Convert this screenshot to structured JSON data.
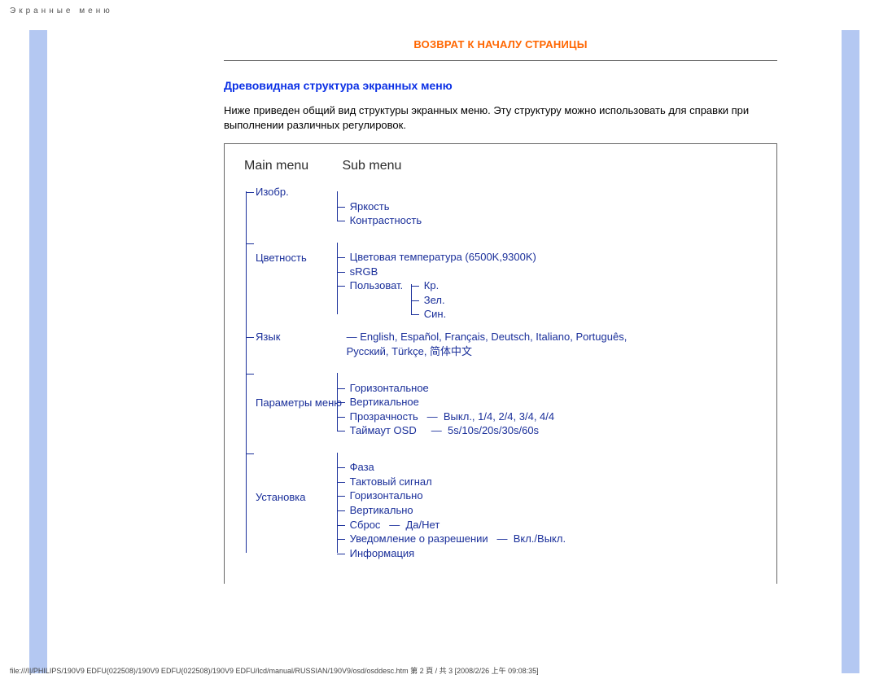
{
  "header_letterspaced": "Экранные меню",
  "back_to_top": "ВОЗВРАТ К НАЧАЛУ СТРАНИЦЫ",
  "section_title": "Древовидная структура экранных меню",
  "body_text": "Ниже приведен общий вид структуры экранных меню. Эту структуру можно использовать для справки при выполнении различных регулировок.",
  "columns": {
    "main": "Main menu",
    "sub": "Sub menu"
  },
  "tree": {
    "image": {
      "label": "Изобр.",
      "brightness": "Яркость",
      "contrast": "Контрастность"
    },
    "color": {
      "label": "Цветность",
      "colortemp": "Цветовая температура (6500K,9300K)",
      "srgb": "sRGB",
      "user": "Пользоват.",
      "r": "Кр.",
      "g": "Зел.",
      "b": "Син."
    },
    "lang": {
      "label": "Язык",
      "options": "English, Español, Français, Deutsch, Italiano, Português, Русский, Türkçe, 简体中文"
    },
    "osd": {
      "label": "Параметры меню",
      "horiz": "Горизонтальное",
      "vert": "Вертикальное",
      "transp": "Прозрачность",
      "transp_opts": "Выкл., 1/4, 2/4, 3/4, 4/4",
      "timeout": "Таймаут OSD",
      "timeout_opts": "5s/10s/20s/30s/60s"
    },
    "setup": {
      "label": "Установка",
      "phase": "Фаза",
      "clock": "Тактовый сигнал",
      "h": "Горизонтально",
      "v": "Вертикально",
      "reset": "Сброс",
      "reset_opts": "Да/Нет",
      "resnotice": "Уведомление о разрешении",
      "resnotice_opts": "Вкл./Выкл.",
      "info": "Информация"
    }
  },
  "footer": "file:///I|/PHILIPS/190V9 EDFU(022508)/190V9 EDFU(022508)/190V9 EDFU/lcd/manual/RUSSIAN/190V9/osd/osddesc.htm 第 2 頁 / 共 3  [2008/2/26 上午 09:08:35]"
}
